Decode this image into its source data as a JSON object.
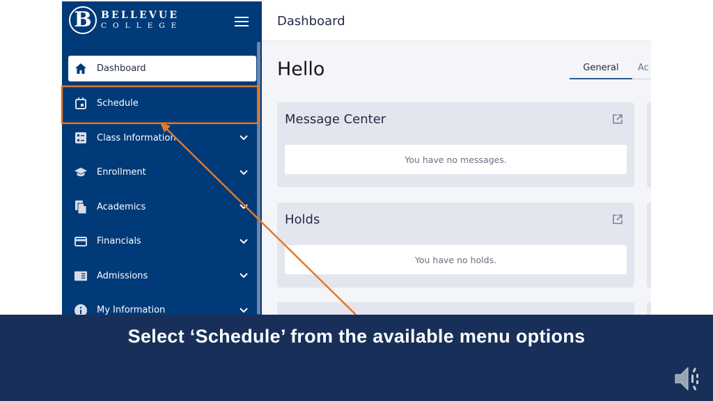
{
  "sidebar": {
    "logo": {
      "line1": "BELLEVUE",
      "line2": "COLLEGE",
      "mark": "B"
    },
    "menu_icon": "hamburger-icon",
    "items": [
      {
        "label": "Dashboard",
        "icon": "home-icon",
        "active": true,
        "expandable": false
      },
      {
        "label": "Schedule",
        "icon": "calendar-icon",
        "active": false,
        "expandable": false,
        "highlighted": true
      },
      {
        "label": "Class Information",
        "icon": "list-icon",
        "active": false,
        "expandable": true
      },
      {
        "label": "Enrollment",
        "icon": "graduation-cap-icon",
        "active": false,
        "expandable": true
      },
      {
        "label": "Academics",
        "icon": "documents-icon",
        "active": false,
        "expandable": true
      },
      {
        "label": "Financials",
        "icon": "credit-card-icon",
        "active": false,
        "expandable": true
      },
      {
        "label": "Admissions",
        "icon": "book-icon",
        "active": false,
        "expandable": true
      },
      {
        "label": "My Information",
        "icon": "info-icon",
        "active": false,
        "expandable": true
      }
    ]
  },
  "header": {
    "title": "Dashboard"
  },
  "main": {
    "greeting": "Hello",
    "tabs": [
      {
        "label": "General",
        "active": true
      },
      {
        "label": "Ac",
        "active": false
      }
    ],
    "cards": [
      {
        "title": "Message Center",
        "body": "You have no messages.",
        "icon": "external-link-icon"
      },
      {
        "title": "Holds",
        "body": "You have no holds.",
        "icon": "external-link-icon"
      }
    ]
  },
  "caption": {
    "text": "Select ‘Schedule’ from the available menu options"
  },
  "colors": {
    "sidebar": "#003a78",
    "highlight": "#e87722",
    "caption_bar": "#183059"
  }
}
